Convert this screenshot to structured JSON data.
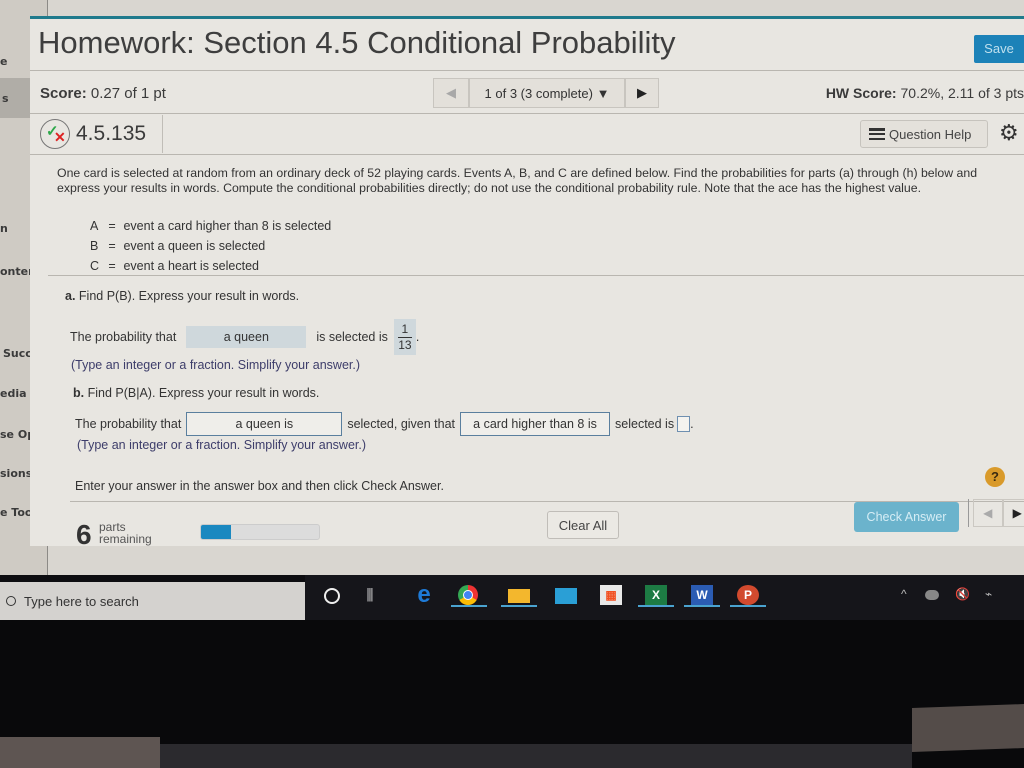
{
  "sidebar": {
    "items": [
      {
        "label": "e"
      },
      {
        "label": "s",
        "active": true
      },
      {
        "label": "n"
      },
      {
        "label": "ontents"
      },
      {
        "label": "Success"
      },
      {
        "label": "edia Librar"
      },
      {
        "label": "se Options"
      },
      {
        "label": "sions"
      },
      {
        "label": "e Tools"
      }
    ]
  },
  "header": {
    "title": "Homework: Section 4.5 Conditional Probability",
    "save_label": "Save",
    "score_label": "Score:",
    "score_value": "0.27 of 1 pt",
    "question_nav": {
      "prev_icon": "◀",
      "current": "1 of 3 (3 complete)",
      "dropdown_icon": "▼",
      "next_icon": "▶"
    },
    "hw_score_label": "HW Score:",
    "hw_score_value": "70.2%, 2.11 of 3 pts"
  },
  "question": {
    "status_icon": "partial-correct-icon",
    "id": "4.5.135",
    "help_label": "Question Help",
    "settings_icon": "gear-icon",
    "problem_text": "One card is selected at random from an ordinary deck of 52 playing cards. Events A, B, and C are defined below. Find the probabilities for parts (a) through (h) below and express your results in words. Compute the conditional probabilities directly; do not use the conditional probability rule. Note that the ace has the highest value.",
    "events": [
      {
        "name": "A",
        "eq": "=",
        "desc": "event a card higher than 8 is selected"
      },
      {
        "name": "B",
        "eq": "=",
        "desc": "event a queen is selected"
      },
      {
        "name": "C",
        "eq": "=",
        "desc": "event a heart is selected"
      }
    ],
    "part_a": {
      "label": "a.",
      "prompt": "Find P(B). Express your result in words.",
      "prefix": "The probability that",
      "answer_phrase": "a queen",
      "middle": "is selected is",
      "fraction": {
        "numerator": "1",
        "denominator": "13"
      },
      "suffix": ".",
      "hint": "(Type an integer or a fraction. Simplify your answer.)"
    },
    "part_b": {
      "label": "b.",
      "prompt": "Find P(B|A). Express your result in words.",
      "prefix": "The probability that",
      "answer_phrase_1": "a queen is",
      "middle": "selected, given that",
      "answer_phrase_2": "a card higher than 8 is",
      "end": "selected is",
      "answer_value": "",
      "suffix": ".",
      "hint": "(Type an integer or a fraction. Simplify your answer.)"
    },
    "instruction": "Enter your answer in the answer box and then click Check Answer.",
    "help_icon": "?"
  },
  "footer": {
    "parts_count": "6",
    "parts_label_1": "parts",
    "parts_label_2": "remaining",
    "progress_fraction": 0.25,
    "clear_label": "Clear All",
    "check_label": "Check Answer",
    "prev_icon": "◀",
    "next_icon": "▶"
  },
  "taskbar": {
    "search_placeholder": "Type here to search",
    "apps": [
      "cortana",
      "task-view",
      "edge",
      "chrome",
      "file-explorer",
      "mail",
      "store",
      "excel",
      "word",
      "powerpoint"
    ],
    "excel_letter": "X",
    "word_letter": "W",
    "ppt_letter": "P",
    "tray_chevron": "^",
    "tray_volume": "🔇"
  },
  "colors": {
    "accent": "#1f7a8c",
    "save": "#1c82b8",
    "check": "#6bb3cc",
    "progress": "#1a88c0"
  }
}
